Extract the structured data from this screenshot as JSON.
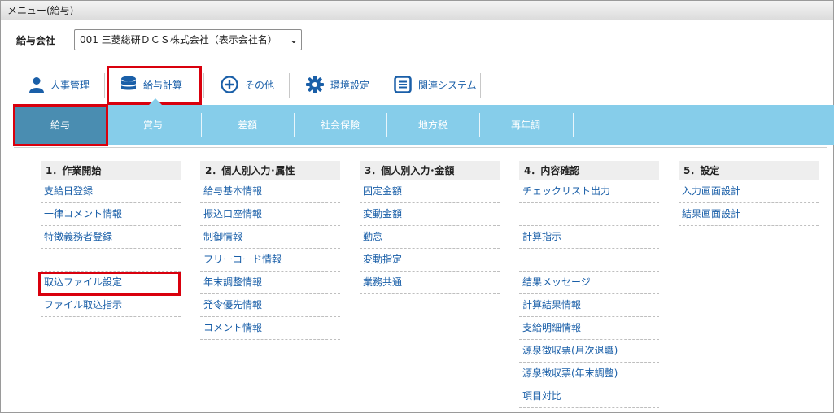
{
  "window": {
    "title": "メニュー(給与)"
  },
  "company": {
    "label": "給与会社",
    "selected": "001 三菱総研ＤＣＳ株式会社（表示会社名）"
  },
  "topnav": [
    {
      "label": "人事管理",
      "icon": "person-icon"
    },
    {
      "label": "給与計算",
      "icon": "database-icon",
      "highlighted": true
    },
    {
      "label": "その他",
      "icon": "plus-circle-icon"
    },
    {
      "label": "環境設定",
      "icon": "gear-icon"
    },
    {
      "label": "関連システム",
      "icon": "list-box-icon"
    }
  ],
  "tabs": [
    {
      "label": "給与",
      "active": true
    },
    {
      "label": "賞与"
    },
    {
      "label": "差額"
    },
    {
      "label": "社会保険"
    },
    {
      "label": "地方税"
    },
    {
      "label": "再年調"
    }
  ],
  "columns": [
    {
      "title": "1．作業開始",
      "items": [
        "支給日登録",
        "一律コメント情報",
        "特徴義務者登録",
        "",
        "取込ファイル設定",
        "ファイル取込指示"
      ]
    },
    {
      "title": "2．個人別入力･属性",
      "items": [
        "給与基本情報",
        "振込口座情報",
        "制御情報",
        "フリーコード情報",
        "年末調整情報",
        "発令優先情報",
        "コメント情報"
      ]
    },
    {
      "title": "3．個人別入力･金額",
      "items": [
        "固定金額",
        "変動金額",
        "勤怠",
        "変動指定",
        "業務共通"
      ]
    },
    {
      "title": "4．内容確認",
      "items": [
        "チェックリスト出力",
        "",
        "計算指示",
        "",
        "結果メッセージ",
        "計算結果情報",
        "支給明細情報",
        "源泉徴収票(月次退職)",
        "源泉徴収票(年末調整)",
        "項目対比"
      ]
    },
    {
      "title": "5．設定",
      "items": [
        "入力画面設計",
        "結果画面設計"
      ]
    }
  ],
  "colors": {
    "tabbar": "#86cdea",
    "tab_active": "#4a8db1",
    "link": "#1a5fa8",
    "highlight": "#d9000d"
  }
}
